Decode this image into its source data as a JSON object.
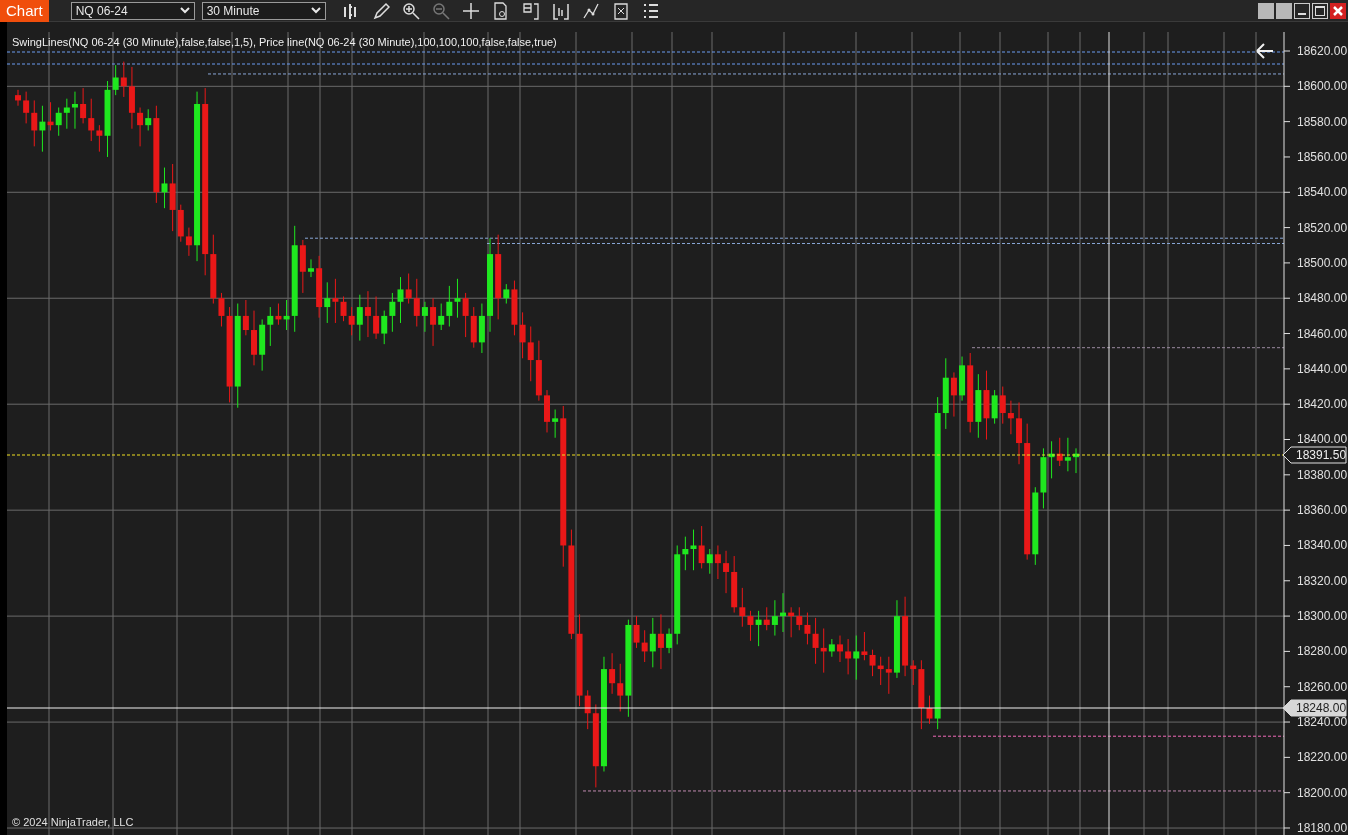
{
  "toolbar": {
    "title": "Chart",
    "instrument": "NQ 06-24",
    "interval": "30 Minute"
  },
  "chart": {
    "indicator_label": "SwingLines(NQ 06-24 (30 Minute),false,false,1,5), Price line(NQ 06-24 (30 Minute),100,100,100,false,false,true)",
    "price_axis": [
      "18620.00",
      "18600.00",
      "18580.00",
      "18560.00",
      "18540.00",
      "18520.00",
      "18500.00",
      "18480.00",
      "18460.00",
      "18440.00",
      "18420.00",
      "18400.00",
      "18380.00",
      "18360.00",
      "18340.00",
      "18320.00",
      "18300.00",
      "18280.00",
      "18260.00",
      "18240.00",
      "18220.00",
      "18200.00",
      "18180.00"
    ],
    "price_markers": [
      {
        "kind": "last",
        "text": "18391.50"
      },
      {
        "kind": "crosshair",
        "text": "18248.00"
      }
    ],
    "copyright": "© 2024 NinjaTrader, LLC"
  }
}
